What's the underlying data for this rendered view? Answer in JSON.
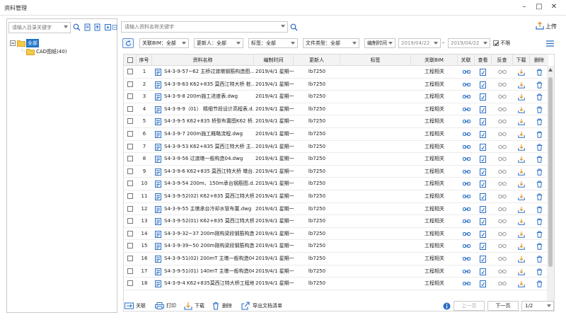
{
  "window": {
    "title": "资料管理"
  },
  "left": {
    "search_placeholder": "请输入目录关键字",
    "tree": {
      "root_label": "全部",
      "child_label": "CAD图纸(40)"
    }
  },
  "main": {
    "search_placeholder": "请输入资料名称关键字",
    "upload_label": "上传",
    "filters": {
      "bim": "关联BIM：全部",
      "updater": "更新人：全部",
      "tag": "标签：全部",
      "filetype": "文件类型：全部",
      "time_mode": "编制时间",
      "date_from": "2019/04/22",
      "date_sep": "–",
      "date_to": "2019/04/22",
      "no_limit_label": "不限",
      "no_limit_checked": true
    },
    "columns": [
      "序号",
      "资料名称",
      "编制时间",
      "更新人",
      "标签",
      "关联BIM",
      "关联",
      "查看",
      "反查",
      "下载",
      "删除"
    ],
    "rows": [
      {
        "no": "1",
        "name": "S4-3-9-57~62 主桥过渡墩钢筋构造图...",
        "time": "2019/4/1 星期一",
        "updater": "lb7250",
        "tag": "",
        "bim": "工程相关"
      },
      {
        "no": "2",
        "name": "S4-3-9-63 K62+835 莫西江特大桥 桩...",
        "time": "2019/4/1 星期一",
        "updater": "lb7250",
        "tag": "",
        "bim": "工程相关"
      },
      {
        "no": "3",
        "name": "S4-3-9-8 200m施工进度表.dwg",
        "time": "2019/4/1 星期一",
        "updater": "lb7250",
        "tag": "",
        "bim": "工程相关"
      },
      {
        "no": "4",
        "name": "S4-3-9-9（01） 精细节段设计高程表.d...",
        "time": "2019/4/1 星期一",
        "updater": "lb7250",
        "tag": "",
        "bim": "工程相关"
      },
      {
        "no": "5",
        "name": "S4-3-9-5 K62+835 桥型布置图K62 桥...",
        "time": "2019/4/1 星期一",
        "updater": "lb7250",
        "tag": "",
        "bim": "工程相关"
      },
      {
        "no": "6",
        "name": "S4-3-9-7 200m施工概略流程.dwg",
        "time": "2019/4/1 星期一",
        "updater": "lb7250",
        "tag": "",
        "bim": "工程相关"
      },
      {
        "no": "7",
        "name": "S4-3-9-53 K62+835 莫西江特大桥 主...",
        "time": "2019/4/1 星期一",
        "updater": "lb7250",
        "tag": "",
        "bim": "工程相关"
      },
      {
        "no": "8",
        "name": "S4-3-9-56 过渡墩一般构造04.dwg",
        "time": "2019/4/1 星期一",
        "updater": "lb7250",
        "tag": "",
        "bim": "工程相关"
      },
      {
        "no": "9",
        "name": "S4-3-9-6 K62+835 莫西江特大桥 墩台...",
        "time": "2019/4/1 星期一",
        "updater": "lb7250",
        "tag": "",
        "bim": "工程相关"
      },
      {
        "no": "10",
        "name": "S4-3-9-54 200m、150m承台钢筋图.d...",
        "time": "2019/4/1 星期一",
        "updater": "lb7250",
        "tag": "",
        "bim": "工程相关"
      },
      {
        "no": "11",
        "name": "S4-3-9-52(02) K62+835 莫西江特大桥...",
        "time": "2019/4/1 星期一",
        "updater": "lb7250",
        "tag": "",
        "bim": "工程相关"
      },
      {
        "no": "12",
        "name": "S4-3-9-55 主墩承台冷却水管布置.dwg",
        "time": "2019/4/1 星期一",
        "updater": "lb7250",
        "tag": "",
        "bim": "工程相关"
      },
      {
        "no": "13",
        "name": "S4-3-9-52(01) K62+835 莫西江特大桥...",
        "time": "2019/4/1 星期一",
        "updater": "lb7250",
        "tag": "",
        "bim": "工程相关"
      },
      {
        "no": "14",
        "name": "S4-3-9-32~37 200m刚构梁段钢筋构造...",
        "time": "2019/4/1 星期一",
        "updater": "lb7250",
        "tag": "",
        "bim": "工程相关"
      },
      {
        "no": "15",
        "name": "S4-3-9-39~50 200m刚构梁段钢筋构造...",
        "time": "2019/4/1 星期一",
        "updater": "lb7250",
        "tag": "",
        "bim": "工程相关"
      },
      {
        "no": "16",
        "name": "S4-3-9-51(02) 200mT 主墩一般构造04...",
        "time": "2019/4/1 星期一",
        "updater": "lb7250",
        "tag": "",
        "bim": "工程相关"
      },
      {
        "no": "17",
        "name": "S4-3-9-51(01) 140mT 主墩一般构造04...",
        "time": "2019/4/1 星期一",
        "updater": "lb7250",
        "tag": "",
        "bim": "工程相关"
      },
      {
        "no": "18",
        "name": "S4-3-9-4 K62+835莫西江特大桥工程地...",
        "time": "2019/4/1 星期一",
        "updater": "lb7250",
        "tag": "",
        "bim": "工程相关"
      }
    ],
    "bottom": {
      "link_label": "关联",
      "print_label": "打印",
      "download_label": "下载",
      "delete_label": "删除",
      "export_label": "导出文档清单",
      "prev_label": "上一页",
      "next_label": "下一页",
      "page": "1/2"
    }
  }
}
